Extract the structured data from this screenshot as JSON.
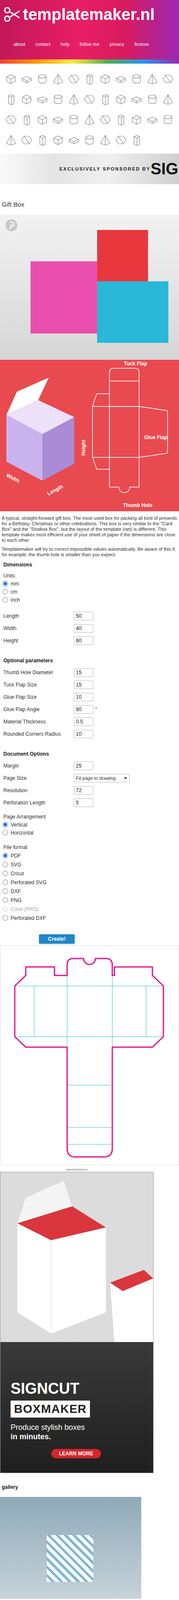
{
  "header": {
    "logo": "templatemaker.nl",
    "nav": [
      "about",
      "contact",
      "help",
      "follow me",
      "privacy",
      "license"
    ]
  },
  "sponsor": {
    "label": "EXCLUSIVELY SPONSORED BY",
    "brand": "SIG"
  },
  "title": "Gift Box",
  "diagram": {
    "tuck_flap": "Tuck Flap",
    "glue_flap": "Glue Flap",
    "thumb_hole": "Thumb Hole",
    "height": "Height",
    "width": "Width",
    "length": "Length"
  },
  "description": [
    "A typical, straight-forward gift box. The most used box for packing all kind of presents for a Birthday, Christmas or other celebrations. This box is very similar to the \"Card Box\" and the \"Shallow Box\", but the layout of the template (net) is different. This template makes most efficient use of your sheet of paper if the dimensions are close to each other.",
    "Templatemaker will try to correct impossible values automatically. Be aware of this if, for example, the thumb hole is smaller than you expect."
  ],
  "dimensions": {
    "heading": "Dimensions",
    "units_label": "Units",
    "units": [
      {
        "label": "mm",
        "selected": true
      },
      {
        "label": "cm",
        "selected": false
      },
      {
        "label": "inch",
        "selected": false
      }
    ],
    "fields": [
      {
        "label": "Length",
        "value": "50"
      },
      {
        "label": "Width",
        "value": "40"
      },
      {
        "label": "Height",
        "value": "60"
      }
    ]
  },
  "optional": {
    "heading": "Optional parameters",
    "fields": [
      {
        "label": "Thumb Hole Diameter",
        "value": "15"
      },
      {
        "label": "Tuck Flap Size",
        "value": "15"
      },
      {
        "label": "Glue Flap Size",
        "value": "10"
      },
      {
        "label": "Glue Flap Angle",
        "value": "80",
        "suffix": "°"
      },
      {
        "label": "Material Thickness",
        "value": "0.5"
      },
      {
        "label": "Rounded Corners Radius",
        "value": "10"
      }
    ]
  },
  "document": {
    "heading": "Document Options",
    "fields": [
      {
        "label": "Margin",
        "value": "25",
        "kind": "input"
      },
      {
        "label": "Page Size",
        "value": "Fit page to drawing",
        "kind": "select"
      },
      {
        "label": "Resolution",
        "value": "72",
        "kind": "input"
      },
      {
        "label": "Perforation Length",
        "value": "5",
        "kind": "input"
      }
    ],
    "arrangement": {
      "label": "Page Arrangement",
      "options": [
        {
          "label": "Vertical",
          "selected": true
        },
        {
          "label": "Horizontal",
          "selected": false
        }
      ]
    },
    "format": {
      "label": "File format",
      "options": [
        {
          "label": "PDF",
          "selected": true,
          "disabled": false
        },
        {
          "label": "SVG",
          "selected": false,
          "disabled": false
        },
        {
          "label": "Cricut",
          "selected": false,
          "disabled": false
        },
        {
          "label": "Perforated SVG",
          "selected": false,
          "disabled": false
        },
        {
          "label": "DXF",
          "selected": false,
          "disabled": false
        },
        {
          "label": "PNG",
          "selected": false,
          "disabled": false
        },
        {
          "label": "Corel (PRO)",
          "selected": false,
          "disabled": true
        },
        {
          "label": "Perforated DXF",
          "selected": false,
          "disabled": false
        }
      ]
    }
  },
  "create_button": "Create!",
  "ad": {
    "label": "advertisement",
    "brand": "SIGNCUT",
    "product": "BOXMAKER",
    "tagline": [
      "Produce stylish boxes",
      "in minutes."
    ],
    "cta": "LEARN MORE"
  },
  "gallery": {
    "heading": "gallery"
  }
}
